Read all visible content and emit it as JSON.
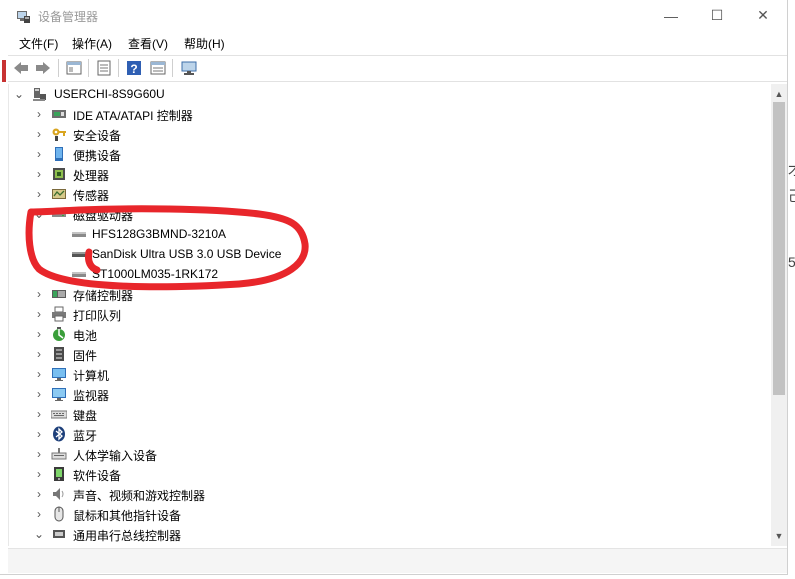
{
  "window": {
    "title": "设备管理器",
    "controls": {
      "minimize": "—",
      "maximize": "☐",
      "close": "✕"
    }
  },
  "menu": [
    {
      "label": "文件(F)"
    },
    {
      "label": "操作(A)"
    },
    {
      "label": "查看(V)"
    },
    {
      "label": "帮助(H)"
    }
  ],
  "toolbar": {
    "buttons": [
      "back-icon",
      "forward-icon",
      "show-hide-console-tree-icon",
      "properties-icon",
      "help-icon",
      "view-icon",
      "monitor-scan-icon"
    ]
  },
  "tree": {
    "root": {
      "label": "USERCHI-8S9G60U",
      "expanded": true
    },
    "categories": [
      {
        "label": "IDE ATA/ATAPI 控制器",
        "expanded": false
      },
      {
        "label": "安全设备",
        "expanded": false
      },
      {
        "label": "便携设备",
        "expanded": false
      },
      {
        "label": "处理器",
        "expanded": false
      },
      {
        "label": "传感器",
        "expanded": false
      },
      {
        "label": "磁盘驱动器",
        "expanded": true,
        "children": [
          {
            "label": "HFS128G3BMND-3210A"
          },
          {
            "label": "SanDisk Ultra USB 3.0 USB Device"
          },
          {
            "label": "ST1000LM035-1RK172"
          }
        ]
      },
      {
        "label": "存储控制器",
        "expanded": false
      },
      {
        "label": "打印队列",
        "expanded": false
      },
      {
        "label": "电池",
        "expanded": false
      },
      {
        "label": "固件",
        "expanded": false
      },
      {
        "label": "计算机",
        "expanded": false
      },
      {
        "label": "监视器",
        "expanded": false
      },
      {
        "label": "键盘",
        "expanded": false
      },
      {
        "label": "蓝牙",
        "expanded": false
      },
      {
        "label": "人体学输入设备",
        "expanded": false
      },
      {
        "label": "软件设备",
        "expanded": false
      },
      {
        "label": "声音、视频和游戏控制器",
        "expanded": false
      },
      {
        "label": "鼠标和其他指针设备",
        "expanded": false
      },
      {
        "label": "通用串行总线控制器",
        "expanded": true
      }
    ]
  },
  "annotation": {
    "color": "#e8262b"
  },
  "edge_fragments": [
    "才",
    "己",
    "5"
  ]
}
